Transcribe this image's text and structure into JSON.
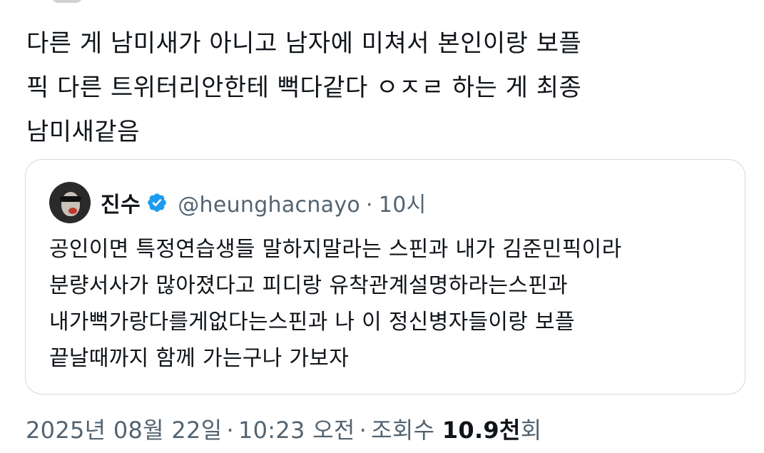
{
  "tweet": {
    "text_lines": [
      "다른 게 남미새가 아니고 남자에 미쳐서 본인이랑 보플",
      "픽 다른 트위터리안한테 뻑다같다 ㅇㅈㄹ 하는 게 최종",
      "남미새같음"
    ],
    "date": "2025년 08월 22일",
    "time": "10:23 오전",
    "separator": "·",
    "views_label": "조회수",
    "views_count": "10.9천",
    "views_suffix": "회"
  },
  "quote": {
    "display_name": "진수",
    "verified_icon": "verified-badge-icon",
    "verified_color": "#1d9bf0",
    "handle": "@heunghacnayo",
    "separator": "·",
    "time_ago": "10시",
    "text_lines": [
      "공인이면 특정연습생들 말하지말라는 스핀과 내가 김준민픽이라",
      "분량서사가 많아졌다고 피디랑 유착관계설명하라는스핀과",
      "내가뻑가랑다를게없다는스핀과 나 이 정신병자들이랑 보플",
      "끝날때까지 함께 가는구나 가보자"
    ]
  },
  "colors": {
    "text_primary": "#0f1419",
    "text_secondary": "#536471",
    "border": "#cfd9de",
    "accent": "#1d9bf0"
  }
}
